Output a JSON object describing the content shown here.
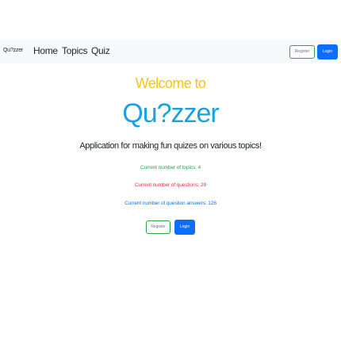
{
  "navbar": {
    "brand": "Qu?zzer",
    "links": [
      "Home",
      "Topics",
      "Quiz"
    ],
    "register_label": "Register",
    "login_label": "Login"
  },
  "main": {
    "welcome": "Welcome to",
    "app_name": "Qu?zzer",
    "tagline": "Application for making fun quizes on various topics!",
    "stats": {
      "topics": "Current number of topics: 4",
      "questions": "Current number of questions: 29",
      "answers": "Current number of question answers: 126"
    },
    "register_label": "Register",
    "login_label": "Login"
  },
  "colors": {
    "welcome": "#f5c518",
    "app_name": "#1ba1e2",
    "topics_stat": "#28a745",
    "questions_stat": "#dc3545",
    "answers_stat": "#0d6efd",
    "primary_button": "#0d6efd",
    "navbar_bg": "#f8f9fa"
  }
}
